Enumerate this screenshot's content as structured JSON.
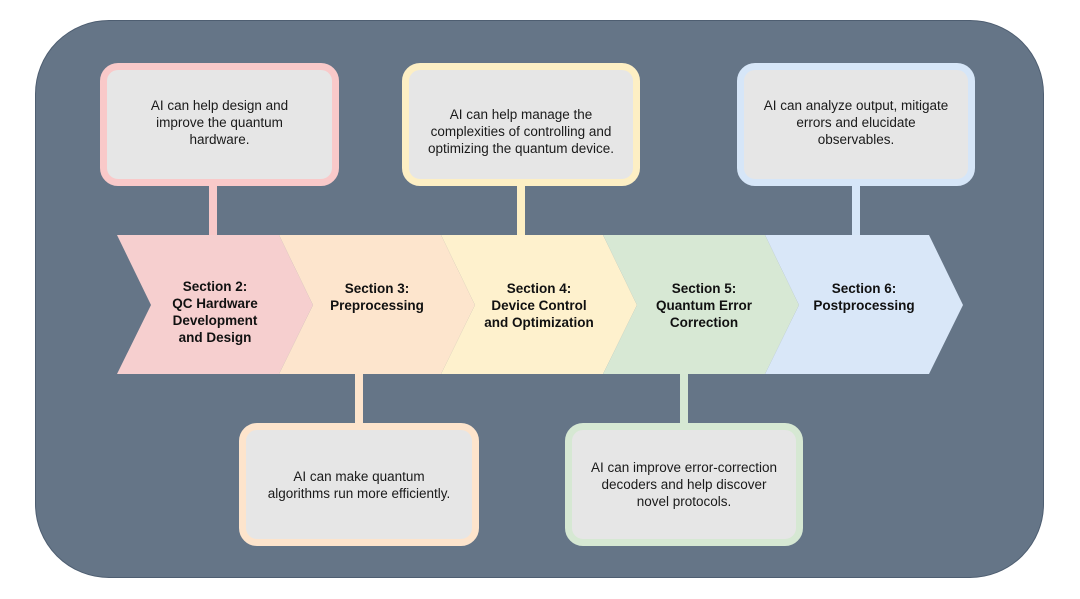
{
  "colors": {
    "panel": "#657587",
    "box_fill": "#e6e6e6",
    "section2": "#f6cfcf",
    "section3": "#fde5cd",
    "section4": "#fef1cd",
    "section5": "#d7e8d4",
    "section6": "#d9e7f8",
    "border2": "#f9c9c9",
    "border3": "#fde4cc",
    "border4": "#fdefc4",
    "border5": "#d6e8d3",
    "border6": "#d6e6f8"
  },
  "sections": [
    {
      "id": "section-2",
      "title": "Section 2:",
      "lines": [
        "QC Hardware",
        "Development",
        "and Design"
      ],
      "description": "AI can help design and improve the quantum hardware.",
      "box_position": "top"
    },
    {
      "id": "section-3",
      "title": "Section 3:",
      "lines": [
        "Preprocessing"
      ],
      "description": "AI can make quantum algorithms run more efficiently.",
      "box_position": "bottom"
    },
    {
      "id": "section-4",
      "title": "Section 4:",
      "lines": [
        "Device Control",
        "and Optimization"
      ],
      "description": "AI can help manage the complexities of controlling and optimizing the quantum device.",
      "box_position": "top"
    },
    {
      "id": "section-5",
      "title": "Section 5:",
      "lines": [
        "Quantum Error",
        "Correction"
      ],
      "description": "AI can improve error-correction decoders and help discover novel protocols.",
      "box_position": "bottom"
    },
    {
      "id": "section-6",
      "title": "Section 6:",
      "lines": [
        "Postprocessing"
      ],
      "description": "AI can analyze output, mitigate errors and elucidate observables.",
      "box_position": "top"
    }
  ],
  "boxes": {
    "box2": [
      "AI can help design and",
      "improve the quantum",
      "hardware."
    ],
    "box3": [
      "AI can make quantum",
      "algorithms run more efficiently."
    ],
    "box4": [
      "AI can help manage the",
      "complexities of controlling and",
      "optimizing the quantum device."
    ],
    "box5": [
      "AI can improve error-correction",
      "decoders and help discover",
      "novel protocols."
    ],
    "box6": [
      "AI can analyze output, mitigate",
      "errors and elucidate",
      "observables."
    ]
  },
  "labels": {
    "s2": [
      "Section 2:",
      "QC Hardware",
      "Development",
      "and Design"
    ],
    "s3": [
      "Section 3:",
      "Preprocessing"
    ],
    "s4": [
      "Section 4:",
      "Device Control",
      "and Optimization"
    ],
    "s5": [
      "Section 5:",
      "Quantum Error",
      "Correction"
    ],
    "s6": [
      "Section 6:",
      "Postprocessing"
    ]
  }
}
